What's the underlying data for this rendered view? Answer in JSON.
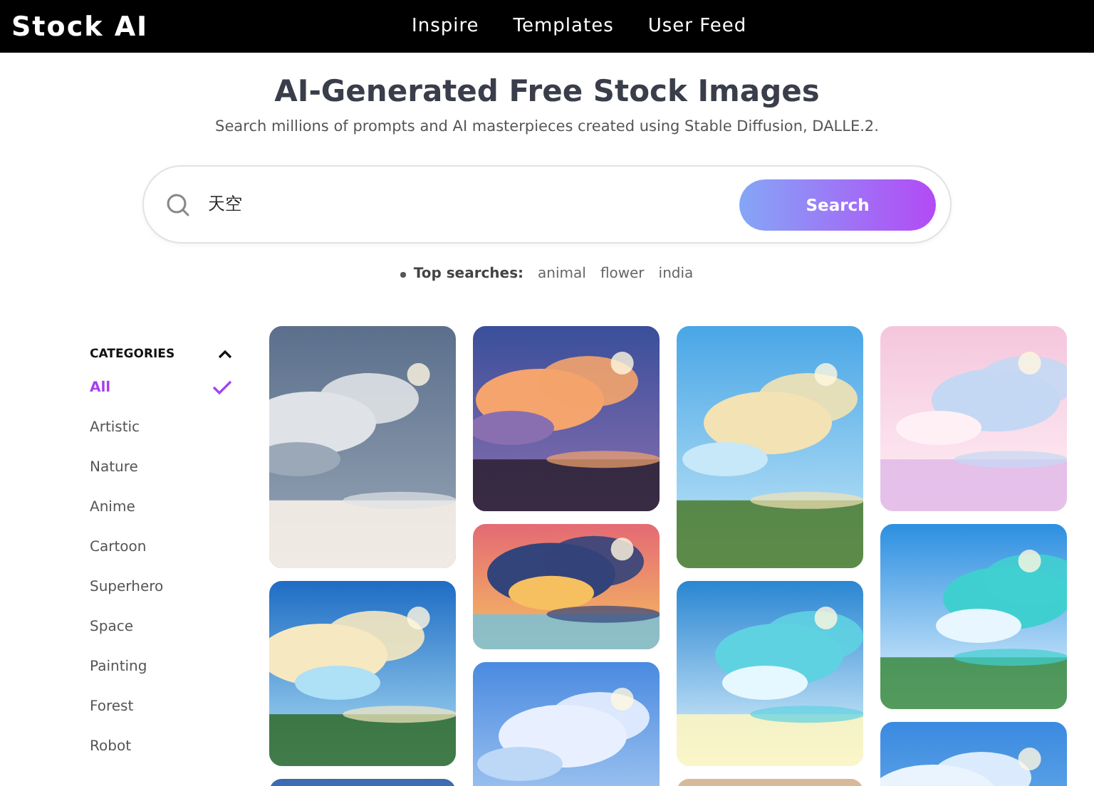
{
  "header": {
    "logo": "Stock AI",
    "nav": [
      {
        "label": "Inspire"
      },
      {
        "label": "Templates"
      },
      {
        "label": "User Feed"
      }
    ]
  },
  "hero": {
    "title": "AI-Generated Free Stock Images",
    "subtitle": "Search millions of prompts and AI masterpieces created using Stable Diffusion, DALLE.2.",
    "search": {
      "value": "天空",
      "button": "Search"
    },
    "top_searches": {
      "label": "Top searches:",
      "terms": [
        "animal",
        "flower",
        "india"
      ]
    }
  },
  "sidebar": {
    "title": "CATEGORIES",
    "expanded": true,
    "items": [
      {
        "label": "All",
        "selected": true
      },
      {
        "label": "Artistic",
        "selected": false
      },
      {
        "label": "Nature",
        "selected": false
      },
      {
        "label": "Anime",
        "selected": false
      },
      {
        "label": "Cartoon",
        "selected": false
      },
      {
        "label": "Superhero",
        "selected": false
      },
      {
        "label": "Space",
        "selected": false
      },
      {
        "label": "Painting",
        "selected": false
      },
      {
        "label": "Forest",
        "selected": false
      },
      {
        "label": "Robot",
        "selected": false
      }
    ]
  }
}
